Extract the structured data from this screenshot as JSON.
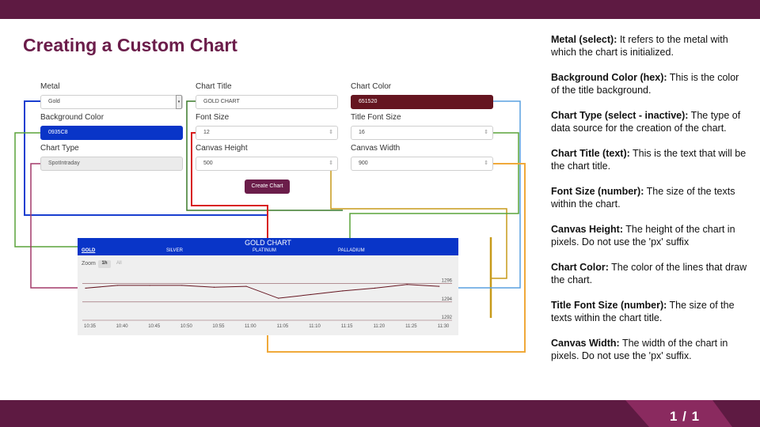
{
  "slide": {
    "title": "Creating a Custom Chart",
    "page": "1 / 1"
  },
  "colors": {
    "brand": "#5e1a42",
    "title": "#6b1d4a",
    "chart_header": "#0935c8",
    "chart_line": "#651520"
  },
  "form": {
    "metal": {
      "label": "Metal",
      "value": "Gold"
    },
    "background_color": {
      "label": "Background Color",
      "value": "0935C8"
    },
    "chart_type": {
      "label": "Chart Type",
      "value": "SpotIntraday"
    },
    "chart_title": {
      "label": "Chart Title",
      "value": "GOLD CHART"
    },
    "font_size": {
      "label": "Font Size",
      "value": "12"
    },
    "canvas_height": {
      "label": "Canvas Height",
      "value": "500"
    },
    "chart_color": {
      "label": "Chart Color",
      "value": "651520"
    },
    "title_font_size": {
      "label": "Title Font Size",
      "value": "16"
    },
    "canvas_width": {
      "label": "Canvas Width",
      "value": "900"
    },
    "create_button": "Create Chart"
  },
  "chart_preview": {
    "title": "GOLD CHART",
    "tabs": [
      "GOLD",
      "SILVER",
      "PLATINUM",
      "PALLADIUM"
    ],
    "zoom_label": "Zoom",
    "zoom_options": [
      "1h",
      "All"
    ]
  },
  "chart_data": {
    "type": "line",
    "title": "GOLD CHART",
    "x": [
      "10:35",
      "10:40",
      "10:45",
      "10:50",
      "10:55",
      "11:00",
      "11:05",
      "11:10",
      "11:15",
      "11:20",
      "11:25",
      "11:30"
    ],
    "y_ticks": [
      1296,
      1294,
      1292
    ],
    "ylim": [
      1292,
      1297
    ],
    "series": [
      {
        "values": [
          1295.5,
          1295.8,
          1295.8,
          1295.8,
          1295.6,
          1295.7,
          1294.4,
          1294.8,
          1295.2,
          1295.5,
          1295.9,
          1295.7
        ]
      }
    ],
    "grid": true
  },
  "notes": [
    {
      "term": "Metal (select):",
      "text": " It refers to the metal with which the chart is initialized."
    },
    {
      "term": "Background Color (hex):",
      "text": " This is the color of the title background."
    },
    {
      "term": "Chart Type (select - inactive):",
      "text": " The type of data source for the creation of the chart."
    },
    {
      "term": "Chart Title (text):",
      "text": " This is the text that will be the chart title."
    },
    {
      "term": "Font Size (number):",
      "text": " The size of the texts within the chart."
    },
    {
      "term": "Canvas Height:",
      "text": " The height of the chart in pixels. Do not use the 'px' suffix"
    },
    {
      "term": "Chart Color:",
      "text": " The color of the lines that draw the chart."
    },
    {
      "term": "Title Font Size (number):",
      "text": " The size of the texts within the chart title."
    },
    {
      "term": "Canvas Width:",
      "text": " The width of the chart in pixels. Do not use the 'px' suffix."
    }
  ]
}
